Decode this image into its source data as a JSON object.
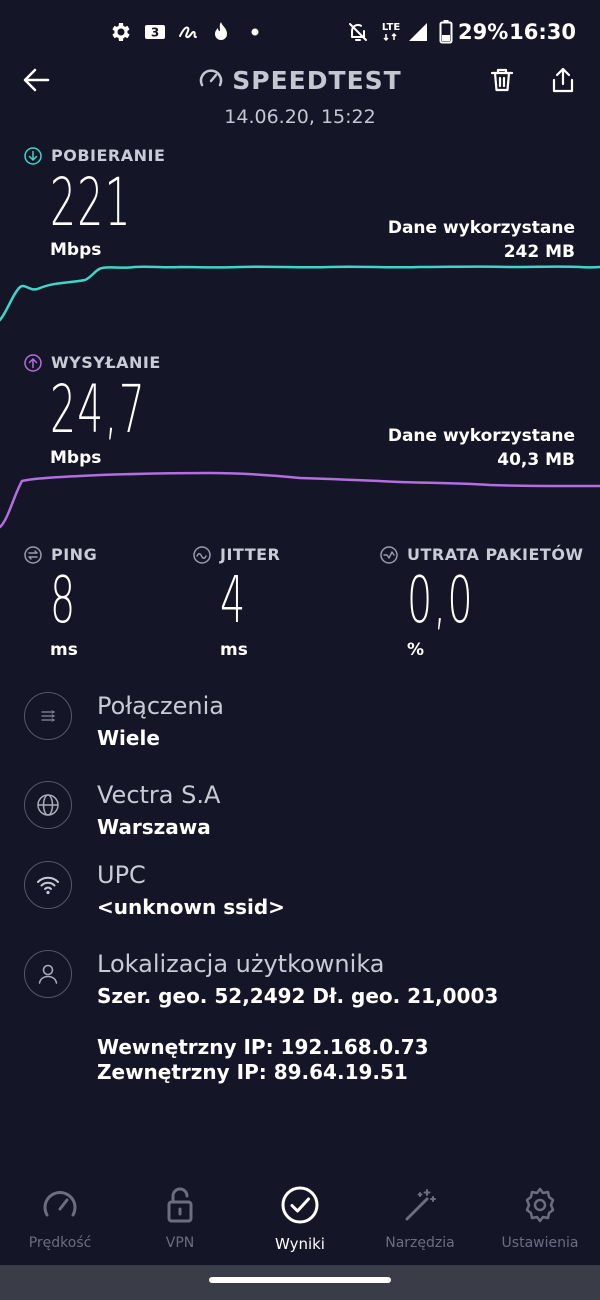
{
  "status_bar": {
    "time": "16:30",
    "battery": "29%",
    "network": "LTE",
    "left_icons": [
      "gear-icon",
      "sim-icon",
      "signature-icon",
      "fire-icon",
      "dot-icon"
    ],
    "right_icons": [
      "bell-off-icon",
      "lte-icon",
      "signal-icon",
      "battery-icon"
    ]
  },
  "header": {
    "title": "SPEEDTEST",
    "date": "14.06.20, 15:22"
  },
  "download": {
    "label": "POBIERANIE",
    "value": "221",
    "unit": "Mbps",
    "data_used_label": "Dane wykorzystane",
    "data_used_value": "242 MB",
    "color": "#3fd6c8"
  },
  "upload": {
    "label": "WYSYŁANIE",
    "value": "24,7",
    "unit": "Mbps",
    "data_used_label": "Dane wykorzystane",
    "data_used_value": "40,3 MB",
    "color": "#b36ee0"
  },
  "metrics": {
    "ping": {
      "label": "PING",
      "value": "8",
      "unit": "ms"
    },
    "jitter": {
      "label": "JITTER",
      "value": "4",
      "unit": "ms"
    },
    "loss": {
      "label": "UTRATA PAKIETÓW",
      "value": "0,0",
      "unit": "%"
    }
  },
  "info": {
    "connections": {
      "title": "Połączenia",
      "value": "Wiele"
    },
    "provider": {
      "title": "Vectra S.A",
      "value": "Warszawa"
    },
    "network": {
      "title": "UPC",
      "value": "<unknown ssid>"
    },
    "location": {
      "title": "Lokalizacja użytkownika",
      "value": "Szer. geo. 52,2492 Dł. geo. 21,0003"
    },
    "internal_ip": "Wewnętrzny IP: 192.168.0.73",
    "external_ip": "Zewnętrzny IP: 89.64.19.51"
  },
  "nav": {
    "items": [
      {
        "label": "Prędkość",
        "icon": "speedometer-icon",
        "active": false
      },
      {
        "label": "VPN",
        "icon": "lock-open-icon",
        "active": false
      },
      {
        "label": "Wyniki",
        "icon": "check-circle-icon",
        "active": true
      },
      {
        "label": "Narzędzia",
        "icon": "wand-icon",
        "active": false
      },
      {
        "label": "Ustawienia",
        "icon": "gear-icon",
        "active": false
      }
    ]
  }
}
